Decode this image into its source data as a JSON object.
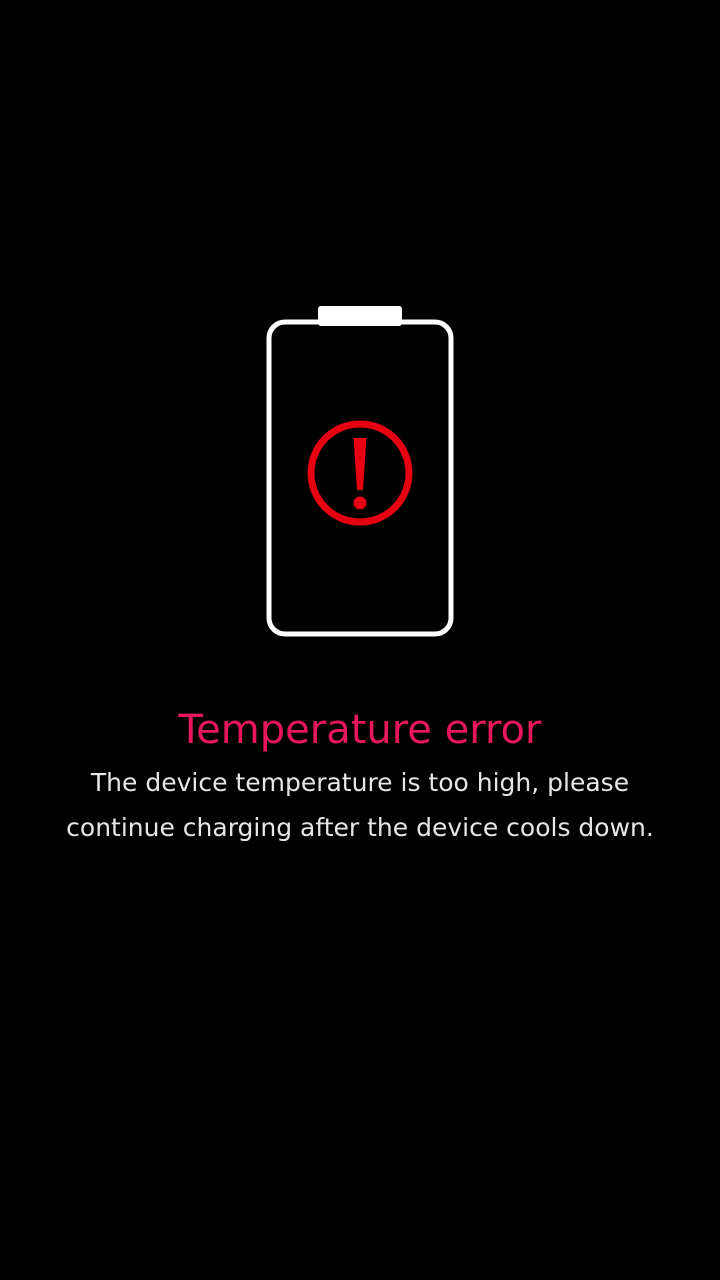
{
  "screen": {
    "background": "#000000"
  },
  "illustration": {
    "battery_icon": "battery-outline-icon",
    "alert_icon": "exclamation-circle-icon",
    "battery_color": "#FFFFFF",
    "alert_color": "#E60012"
  },
  "error": {
    "title": "Temperature error",
    "title_color": "#E8175D",
    "message": "The device temperature is too high, please continue charging after the device cools down.",
    "message_color": "#E6E6E6"
  }
}
